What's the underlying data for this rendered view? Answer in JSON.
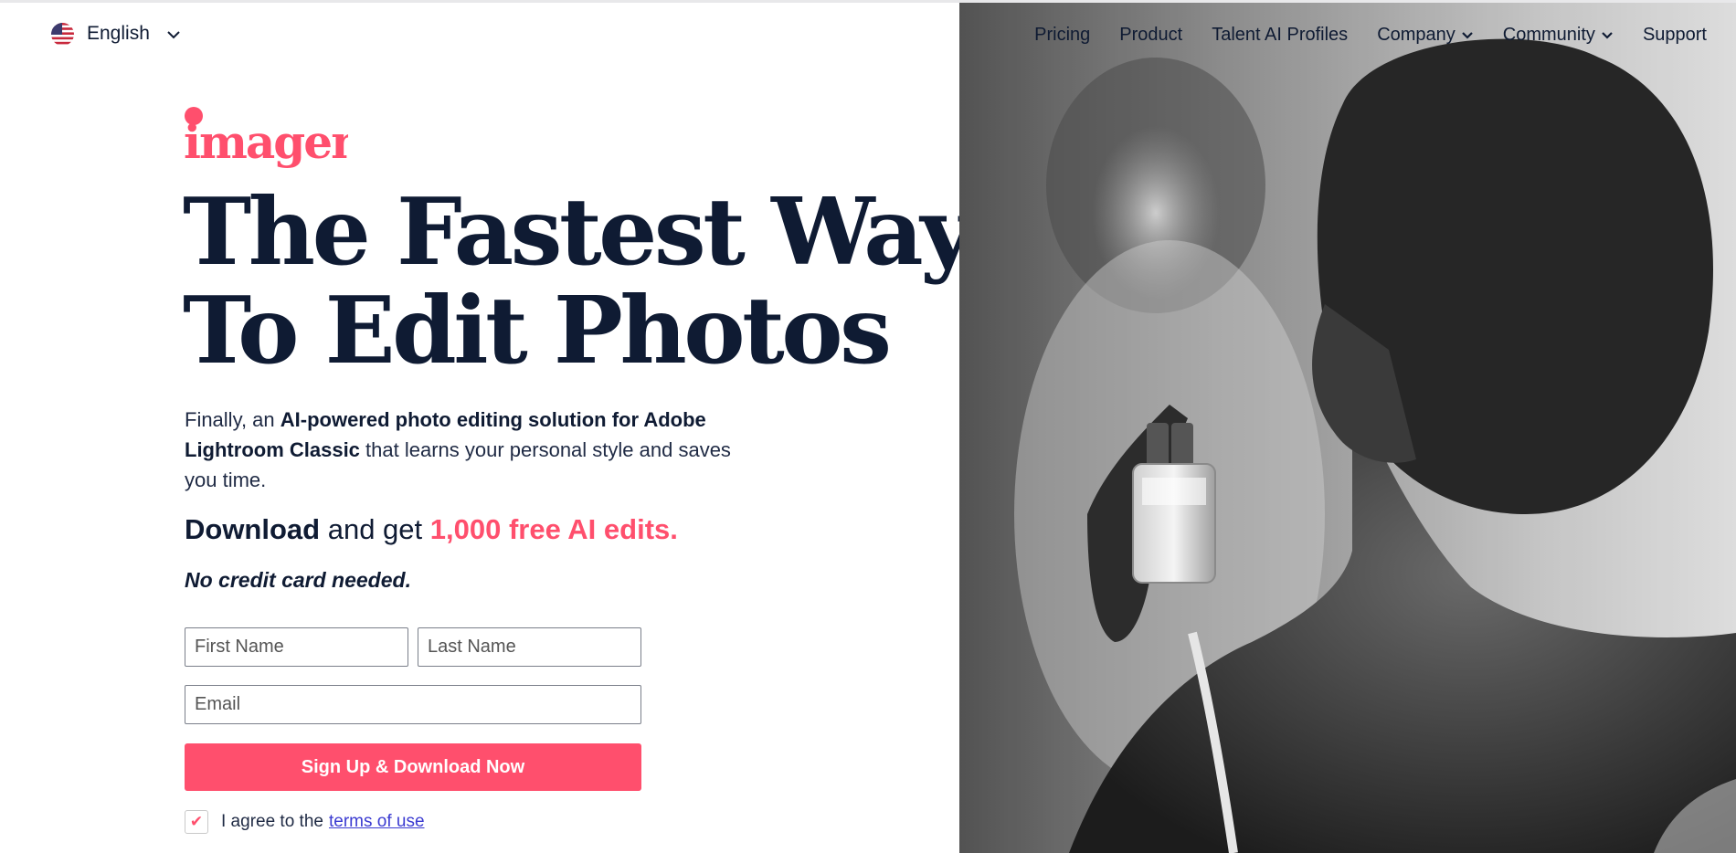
{
  "language": {
    "label": "English",
    "flag_icon": "us-flag-icon",
    "chevron_icon": "chevron-down-icon"
  },
  "brand": {
    "logo_text": "imagen",
    "accent_color": "#ff4f6d",
    "text_color": "#0f1b33"
  },
  "nav": {
    "items": [
      {
        "label": "Pricing",
        "has_dropdown": false
      },
      {
        "label": "Product",
        "has_dropdown": false
      },
      {
        "label": "Talent AI Profiles",
        "has_dropdown": false
      },
      {
        "label": "Company",
        "has_dropdown": true
      },
      {
        "label": "Community",
        "has_dropdown": true
      },
      {
        "label": "Support",
        "has_dropdown": false
      }
    ]
  },
  "hero": {
    "headline_line1": "The Fastest Way",
    "headline_line2": "To Edit Photos",
    "intro": {
      "prefix": "Finally, an ",
      "bold": "AI-powered photo editing solution for Adobe Lightroom Classic",
      "suffix": " that learns your personal style and saves you time."
    },
    "offer": {
      "strong": "Download",
      "middle": " and get ",
      "accent": "1,000 free AI edits."
    },
    "note": "No credit card needed."
  },
  "form": {
    "first_name_placeholder": "First Name",
    "last_name_placeholder": "Last Name",
    "email_placeholder": "Email",
    "submit_label": "Sign Up & Download Now",
    "terms_checked": true,
    "terms_prefix": "I agree to the",
    "terms_link": "terms of use"
  }
}
